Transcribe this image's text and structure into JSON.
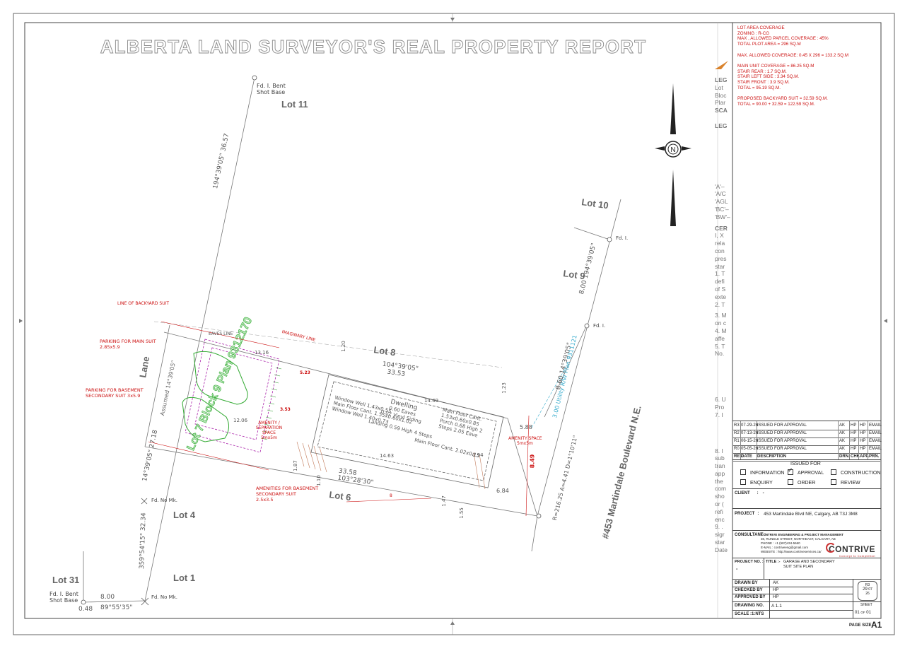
{
  "title": "ALBERTA LAND SURVEYOR'S REAL PROPERTY REPORT",
  "coverage": {
    "lines": [
      "LOT AREA COVERAGE",
      "ZONING : R-CG",
      "MAX , ALLOWED PARCEL COVERAGE : 45%",
      "TOTAL PLOT AREA = 296 SQ.M",
      "",
      "MAX. ALLOWED COVERAGE: 0.45 X 296 = 133.2 SQ.M",
      "",
      "MAIN UNIT COVERAGE = 86.25 SQ.M",
      "STAIR REAR : 1.7 SQ.M.",
      "STAIR LEFT SIDE : 3.34 SQ.M.",
      "STAIR FRONT : 3.9 SQ.M.",
      "TOTAL = 95.19 SQ.M.",
      "",
      "PROPOSED BACKYARD SUIT = 32.59 SQ.M.",
      "TOTAL = 90.00 + 32.59 = 122.59 SQ.M."
    ]
  },
  "legend_partial": {
    "lines": [
      "LEG",
      "Lot",
      "Bloc",
      "Plar",
      "SCA",
      "",
      "LEG",
      "",
      "",
      "",
      "",
      "",
      "",
      "",
      "",
      "'A'–",
      "'A/C",
      "'AGL",
      "'BC'–",
      "'BW'–",
      "",
      "CER",
      "I, X",
      "rela",
      "con",
      "pres",
      "star",
      "1. T",
      "defi",
      "of S",
      "exte",
      "2. T",
      "",
      "3. M",
      "on c",
      "4. M",
      "affe",
      "5. T",
      "No.",
      "",
      "",
      "",
      "",
      "",
      "6. U",
      "Pro",
      "7. I",
      "",
      "",
      "",
      "",
      "8. I",
      "sub",
      "tran",
      "app",
      "the",
      "com",
      "sho",
      "or (",
      "refi",
      "enc",
      "9. .",
      "sigr",
      "star",
      "Date"
    ]
  },
  "lots": {
    "lot11": "Lot 11",
    "lot10": "Lot 10",
    "lot9": "Lot 9",
    "lot8": "Lot 8",
    "lot6": "Lot 6",
    "lot4": "Lot 4",
    "lot1": "Lot 1",
    "lot31": "Lot 31",
    "lane": "Lane",
    "street": "#453 Martindale Boulevard N.E.",
    "assumed": "Assumed 14°39'05\"",
    "lotblock": "Lot 7 Block 9 Plan 9312170"
  },
  "survey": {
    "fd_bent_1": "Fd. I. Bent",
    "shot_base_1": "Shot Base",
    "fd_bent_2": "Fd. I. Bent",
    "shot_base_2": "Shot Base",
    "fd_i_1": "Fd. I.",
    "fd_i_2": "Fd. I.",
    "fd_i_3": "Fd. I.",
    "fd_nomk_1": "Fd. No Mk.",
    "fd_nomk_2": "Fd. No Mk.",
    "fd_nomk_3": "Fd. No Mk.",
    "fd_nomk_4": "Fd. No Mk.",
    "fd_nomk_5": "Fd. No Mk.",
    "bearing_west": "194°39'05\"",
    "dist_west": "36.57",
    "bearing_east": "194°39'05\"",
    "dist_east_top": "8.00",
    "bearing_rear": "14°39'05\"",
    "dist_rear": "8.60",
    "bearing_front": "14°39'05\"",
    "dist_front": "4.07",
    "bearing_top": "104°39'05\"",
    "dist_top": "33.53",
    "bearing_bottom": "103°28'30\"",
    "dist_bottom": "33.58",
    "bearing_sw": "14°39'05\"",
    "dist_sw": "27.18",
    "bearing_s": "359°54'15\"",
    "dist_s": "32.34",
    "bearing_base": "89°55'35\"",
    "dist_base": "8.00",
    "dist_small": "0.48",
    "curve": "R=216.25 A=4.41 D=1°10'11\"",
    "utility": "3.00 Utility R/W Plan 9311121"
  },
  "dwelling": {
    "label": "Dwelling",
    "eaves": "0.60 Eaves",
    "siding": "0.02 Vinyl Siding",
    "window1": "Window Well 1.43x0.55",
    "cant1": "Main Floor Cant. 1.55x0.60x1.02",
    "window2": "Window Well 1.40x0.73",
    "landing": "Landing 0.59 High 4 Steps",
    "cant2": "Main Floor Cant. 2.02x0.15",
    "cant3": "Main Floor Cant. 1.53x0.60x0.85",
    "porch": "Porch 0.68 High 2 Steps 2.05 Eave",
    "dim_1449": "14.49",
    "dim_1463": "14.63",
    "dim_588": "5.88",
    "dim_849": "8.49",
    "dim_684": "6.84",
    "dim_120": "1.20",
    "dim_123": "1.23",
    "dim_147": "1.47",
    "dim_155": "1.55",
    "dim_187": "1.87",
    "dim_110": "1.10",
    "dim_094": "0.94"
  },
  "annotations": {
    "backyard_suit": "LINE OF BACKYARD SUIT",
    "parking_main": "PARKING FOR MAIN SUIT",
    "parking_main_dim": "2.85x5.9",
    "parking_base": "PARKING FOR BASEMENT",
    "parking_base2": "SECONDARY SUIT 3x5.9",
    "eaves_line": "EAVES LINE",
    "imaginary": "IMAGINARY LINE",
    "amenity_sep": "AMENITY / SEPARATION SPACE",
    "amenity_sep_dim": "5mx5m",
    "amenities_base": "AMENITIES FOR BASEMENT",
    "amenities_base2": "SECONDARY SUIT",
    "amenities_base_dim": "2.5x3.5",
    "amenity_space": "AMENITY SPACE",
    "amenity_space_dim": "5mx5m",
    "dim_1316": "13.16",
    "dim_1206": "12.06",
    "dim_523": "5.23",
    "dim_353": "3.53",
    "dim_8": "8"
  },
  "revisions": [
    {
      "rev": "R3",
      "date": "07-29-26",
      "desc": "ISSUED FOR APPROVAL",
      "drn": "AK",
      "chk": "HP",
      "app": "HP",
      "prn": "EMAIL"
    },
    {
      "rev": "R2",
      "date": "07-13-26",
      "desc": "ISSUED FOR APPROVAL",
      "drn": "AK",
      "chk": "HP",
      "app": "HP",
      "prn": "EMAIL"
    },
    {
      "rev": "R1",
      "date": "06-15-26",
      "desc": "ISSUED FOR APPROVAL",
      "drn": "AK",
      "chk": "HP",
      "app": "HP",
      "prn": "EMAIL"
    },
    {
      "rev": "R0",
      "date": "05-05-26",
      "desc": "ISSUED FOR APPROVAL",
      "drn": "AK",
      "chk": "HP",
      "app": "HP",
      "prn": "EMAIL"
    }
  ],
  "rev_header": {
    "rev": "REV.",
    "date": "DATE",
    "desc": "DESCRIPTION",
    "drn": "DRN.",
    "chk": "CHK",
    "app": "APP.",
    "prn": "PRN."
  },
  "issued_for": {
    "title": "ISSUED FOR",
    "information": "INFORMATION",
    "approval": "APPROVAL",
    "construction": "CONSTRUCTION",
    "enquiry": "ENQUIRY",
    "order": "ORDER",
    "review": "REVIEW"
  },
  "client": {
    "label": "CLIENT",
    "sep": ":",
    "value": "-"
  },
  "project": {
    "label": "PROJECT",
    "sep": ":",
    "value": "453 Martindale Blvd NE, Calgary, AB T3J 3M8"
  },
  "consultant": {
    "label": "CONSULTANT :",
    "name": "CONTRIVE ENGINEERING & PROJECT MANAGEMENT",
    "address": "36, RUNDLE STREET, NORTHEAST, CALGARY, AB",
    "phone_label": "PHONE",
    "phone": ": +1 (587)434-5660",
    "email_label": "E-MAIL",
    "email": ": contriveeng@gmail.com",
    "web_label": "WEBSITE",
    "web": ": http://www.contriveservices.ca/",
    "logo_text": "CONTRIVE",
    "logo_tag": "Concept to Completion"
  },
  "project_no": {
    "label": "PROJECT NO. :-",
    "value": "-",
    "title_label": "TITLE :-",
    "title_value": "GARAGE AND SECONDARY SUIT SITE PLAN"
  },
  "drawn_by": {
    "label": "DRAWN BY",
    "value": "AK"
  },
  "checked_by": {
    "label": "CHECKED BY",
    "value": "HP"
  },
  "approved_by": {
    "label": "APPROVED BY",
    "value": "HP"
  },
  "drawing_no": {
    "label": "DRAWING NO.",
    "value": "A 1.1"
  },
  "scale": {
    "label": "SCALE :1:NTS"
  },
  "rev_stamp": {
    "rev": "R3",
    "day": "29",
    "month": "07",
    "year": "26"
  },
  "sheet": {
    "label": "SHEET",
    "num": "01",
    "of": "OF",
    "total": "01"
  },
  "page_size": {
    "label": "PAGE SIZE",
    "value": "A1"
  },
  "north": "N",
  "colors": {
    "frame": "#555555",
    "red": "#cc1111",
    "green": "#22aa22",
    "magenta": "#aa22aa",
    "cyan": "#33aacc",
    "line": "#555555"
  }
}
